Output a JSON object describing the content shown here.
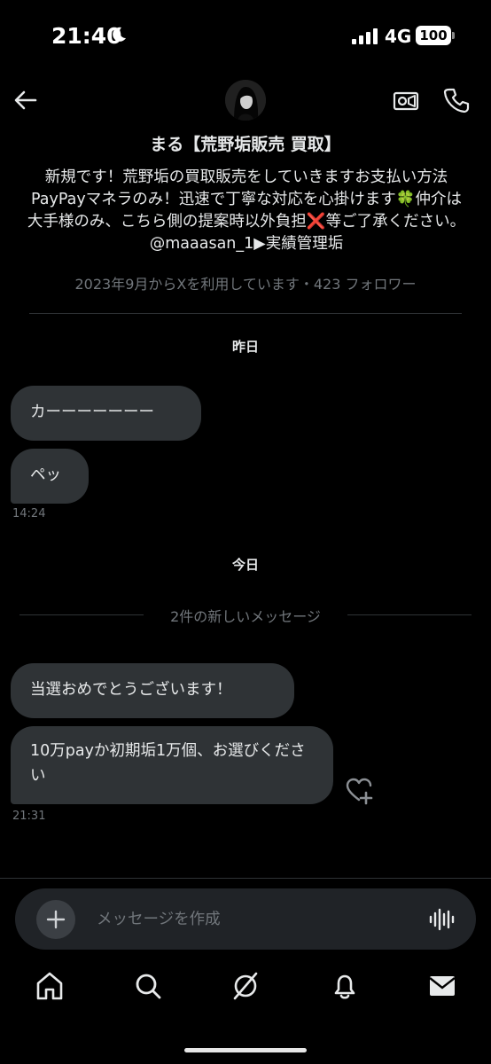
{
  "status_bar": {
    "time": "21:40",
    "network": "4G",
    "battery": "100"
  },
  "header": {
    "profile_name": "まる【荒野垢販売 買取】",
    "bio": "新規です！荒野垢の買取販売をしていきますお支払い方法PayPayマネラのみ！迅速で丁寧な対応を心掛けます🍀仲介は大手様のみ、こちら側の提案時以外負担❌等ご了承ください。@maaasan_1▶実績管理垢",
    "meta": "2023年9月からXを利用しています・423 フォロワー"
  },
  "conversation": {
    "day1": "昨日",
    "day1_messages": [
      "カーーーーーーー",
      "ペッ"
    ],
    "day1_time": "14:24",
    "day2": "今日",
    "new_messages_label": "2件の新しいメッセージ",
    "day2_messages": [
      "当選おめでとうございます！",
      "10万payか初期垢1万個、お選びください"
    ],
    "day2_time": "21:31"
  },
  "composer": {
    "placeholder": "メッセージを作成"
  },
  "tabs": [
    "home-icon",
    "search-icon",
    "grok-icon",
    "notifications-icon",
    "messages-icon"
  ]
}
